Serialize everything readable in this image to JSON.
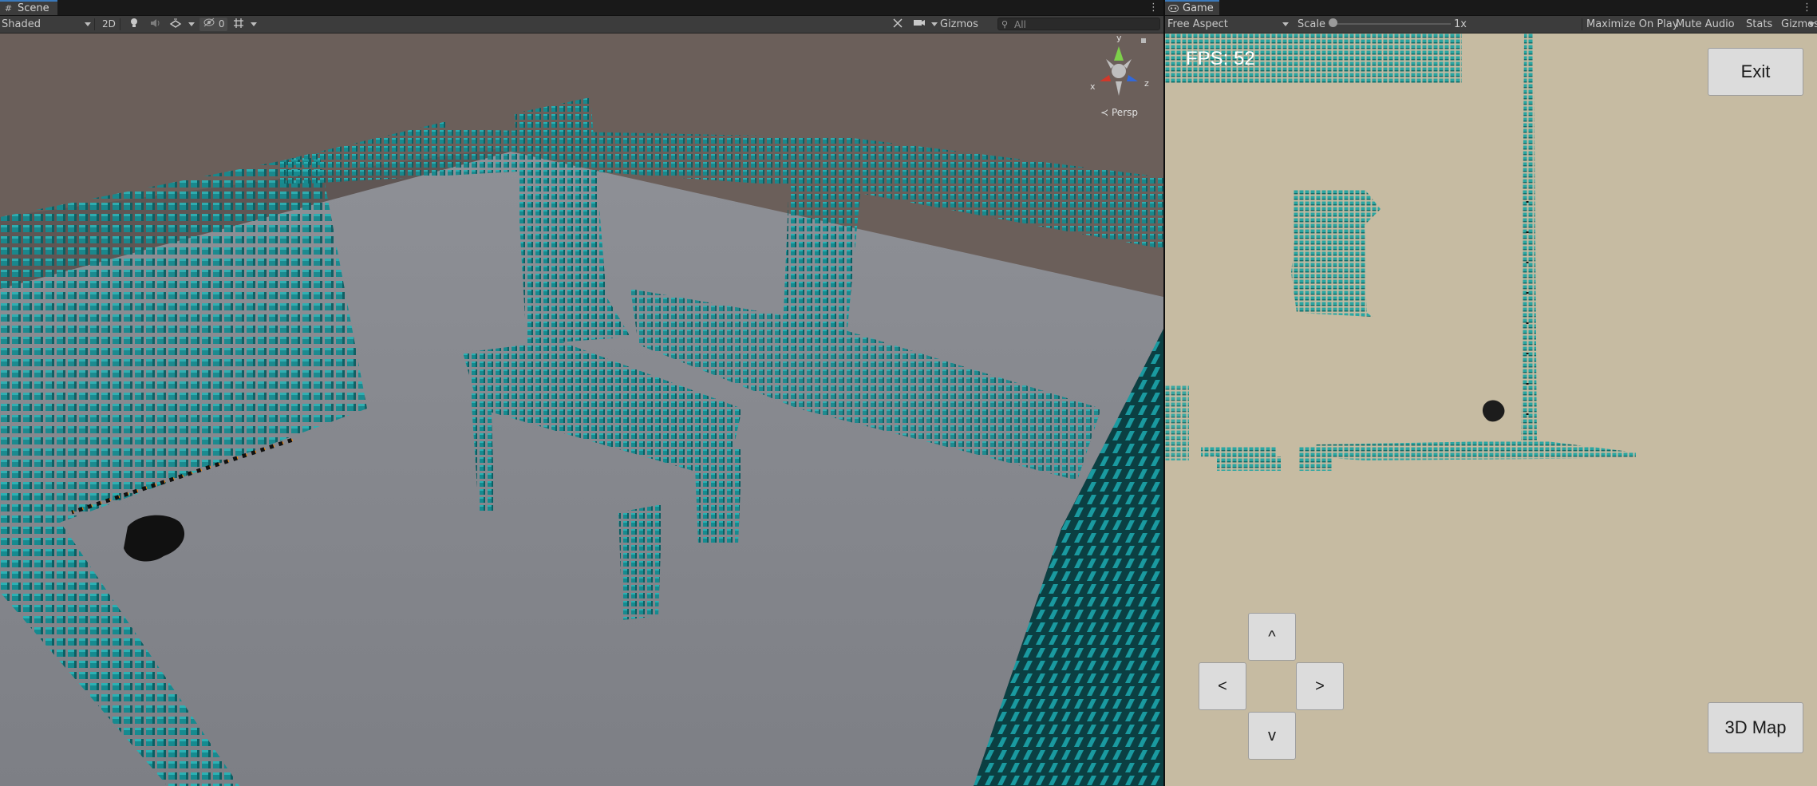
{
  "scene_panel": {
    "tab": {
      "label": "Scene",
      "icon": "scene-hash-icon"
    },
    "toolbar": {
      "shading_mode": "Shaded",
      "mode_2d": "2D",
      "hidden_count": "0",
      "gizmos_label": "Gizmos",
      "search_placeholder": "All"
    },
    "orientation_gizmo": {
      "y_label": "y",
      "x_label": "x",
      "z_label": "z",
      "projection_label": "Persp"
    },
    "colors": {
      "floor": "#85878c",
      "voxel": "#19898e",
      "wall_far": "#6e625b"
    }
  },
  "game_panel": {
    "tab": {
      "label": "Game",
      "icon": "gamepad-icon"
    },
    "toolbar": {
      "aspect": "Free Aspect",
      "scale_label": "Scale",
      "scale_value": "1x",
      "maximize_on_play": "Maximize On Play",
      "mute_audio": "Mute Audio",
      "stats": "Stats",
      "gizmos_label": "Gizmos"
    },
    "hud": {
      "fps": "FPS: 52",
      "exit_button": "Exit",
      "map_3d_button": "3D Map",
      "dpad": {
        "up": "^",
        "left": "<",
        "right": ">",
        "down": "v"
      }
    },
    "colors": {
      "ground": "#c6bba2",
      "voxel": "#1fa9a3"
    }
  }
}
